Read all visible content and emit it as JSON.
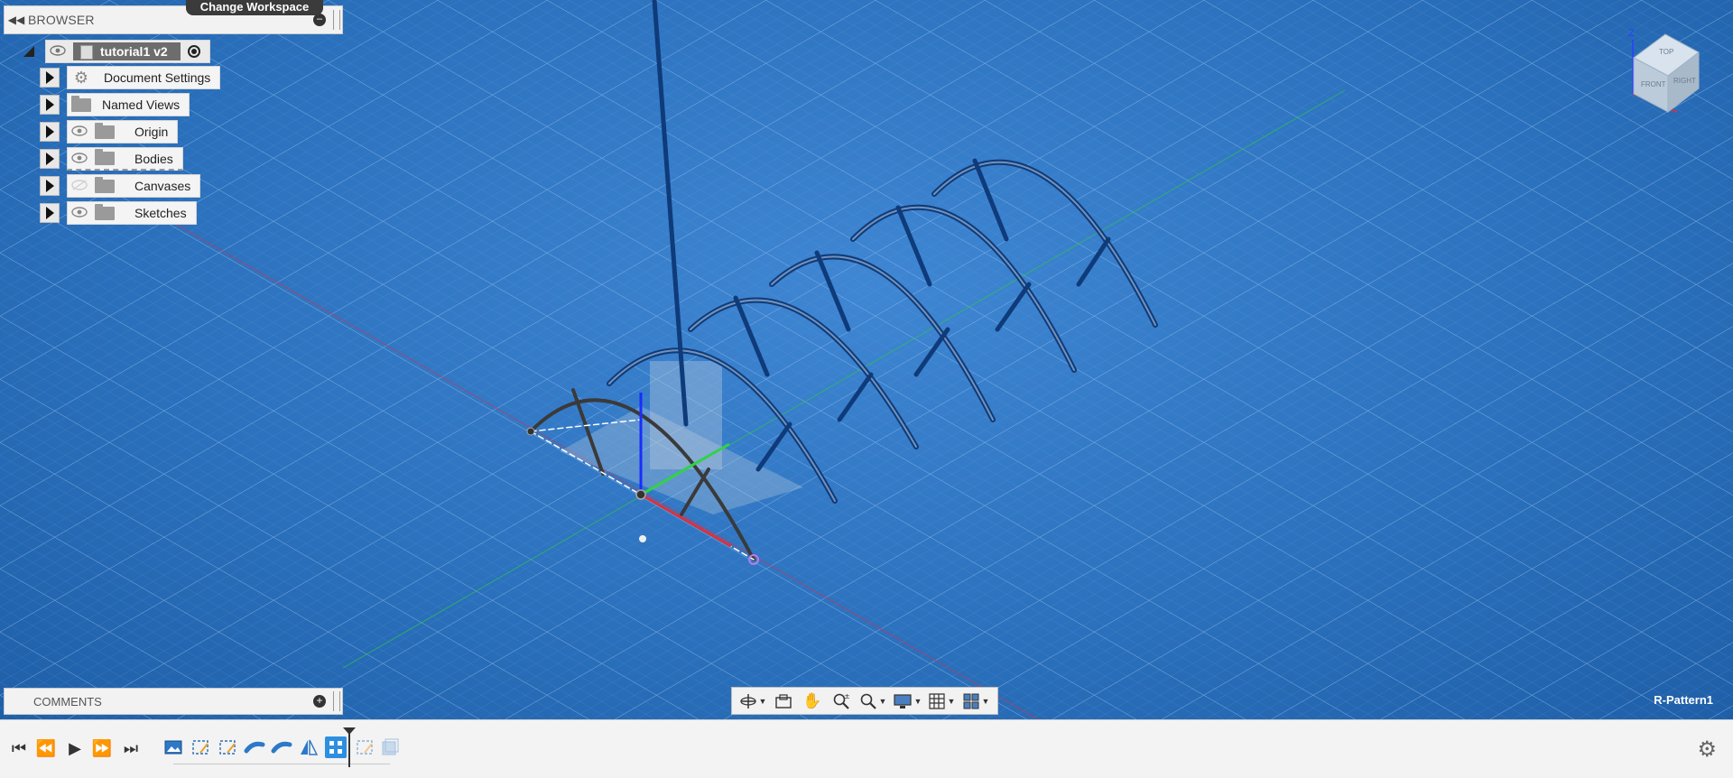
{
  "tooltip": {
    "change_workspace": "Change Workspace"
  },
  "browser": {
    "title": "BROWSER",
    "root": {
      "label": "tutorial1 v2"
    },
    "items": [
      {
        "label": "Document Settings",
        "icon": "gear-icon",
        "has_eye": false
      },
      {
        "label": "Named Views",
        "icon": "folder-icon",
        "has_eye": false
      },
      {
        "label": "Origin",
        "icon": "folder-icon",
        "has_eye": true
      },
      {
        "label": "Bodies",
        "icon": "folder-icon",
        "has_eye": true
      },
      {
        "label": "Canvases",
        "icon": "folder-icon",
        "has_eye": true
      },
      {
        "label": "Sketches",
        "icon": "folder-icon",
        "has_eye": true
      }
    ]
  },
  "comments": {
    "title": "COMMENTS"
  },
  "viewport": {
    "status_label": "R-Pattern1",
    "viewcube_faces": [
      "TOP",
      "FRONT",
      "RIGHT"
    ],
    "axis_z": "Z",
    "colors": {
      "background": "#2c72be",
      "grid": "#7fb3e8",
      "arch": "#0f3b7a",
      "selected_arch": "#3a3a3a",
      "axis_x": "#e0303a",
      "axis_y": "#31d14a",
      "axis_z": "#1a2cff"
    }
  },
  "nav_toolbar": {
    "buttons": [
      "orbit-icon",
      "look-at-icon",
      "pan-icon",
      "zoom-icon",
      "fit-icon",
      "display-settings-icon",
      "grid-settings-icon",
      "viewports-icon"
    ]
  },
  "timeline": {
    "controls": [
      "go-to-start",
      "step-back",
      "play",
      "step-forward",
      "go-to-end"
    ],
    "features": [
      "canvas",
      "sketch",
      "sketch",
      "sweep",
      "sweep",
      "mirror",
      "rectangular-pattern",
      "sketch",
      "body"
    ]
  }
}
